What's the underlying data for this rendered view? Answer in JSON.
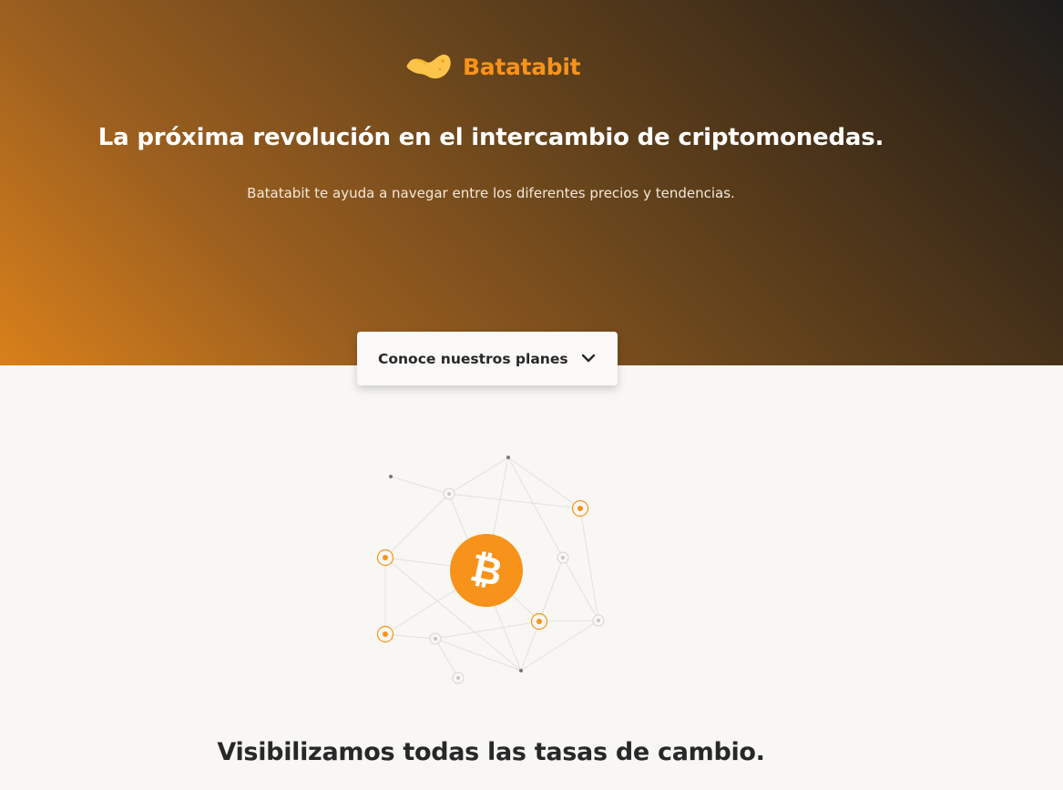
{
  "brand": {
    "name": "Batatabit",
    "icon": "sweet-potato-icon",
    "color": "#f7931a"
  },
  "hero": {
    "title": "La próxima revolución en el intercambio de criptomonedas.",
    "subtitle": "Batatabit te ayuda a navegar entre los diferentes precios y tendencias."
  },
  "plans_button": {
    "label": "Conoce nuestros planes",
    "icon": "chevron-down-icon"
  },
  "illustration": {
    "icon": "bitcoin-icon",
    "accent": "#f7931a"
  },
  "section": {
    "title": "Visibilizamos todas las tasas de cambio."
  }
}
